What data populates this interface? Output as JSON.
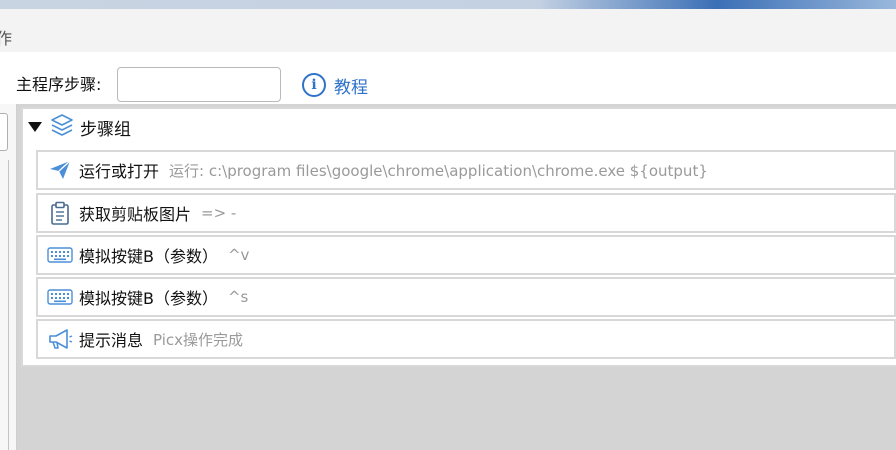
{
  "window": {
    "title_fragment": "作"
  },
  "toolbar": {
    "step_label": "主程序步骤:",
    "step_input_value": "",
    "tutorial_label": "教程",
    "info_glyph": "i"
  },
  "group": {
    "title": "步骤组",
    "expanded": true,
    "icon": "layers-icon"
  },
  "steps": [
    {
      "name": "运行或打开",
      "detail": "运行: c:\\program files\\google\\chrome\\application\\chrome.exe ${output}",
      "icon": "send-icon"
    },
    {
      "name": "获取剪贴板图片",
      "detail": "=> -",
      "icon": "clipboard-icon"
    },
    {
      "name": "模拟按键B（参数）",
      "detail": "^v",
      "icon": "keyboard-icon"
    },
    {
      "name": "模拟按键B（参数）",
      "detail": "^s",
      "icon": "keyboard-icon"
    },
    {
      "name": "提示消息",
      "detail": "Picx操作完成",
      "icon": "megaphone-icon"
    }
  ],
  "colors": {
    "accent": "#2f72c9",
    "icon_blue": "#4a8fd8",
    "row_border": "#d8d8d8",
    "panel_bg": "#d4d4d4",
    "detail_text": "#9a9a9a"
  }
}
